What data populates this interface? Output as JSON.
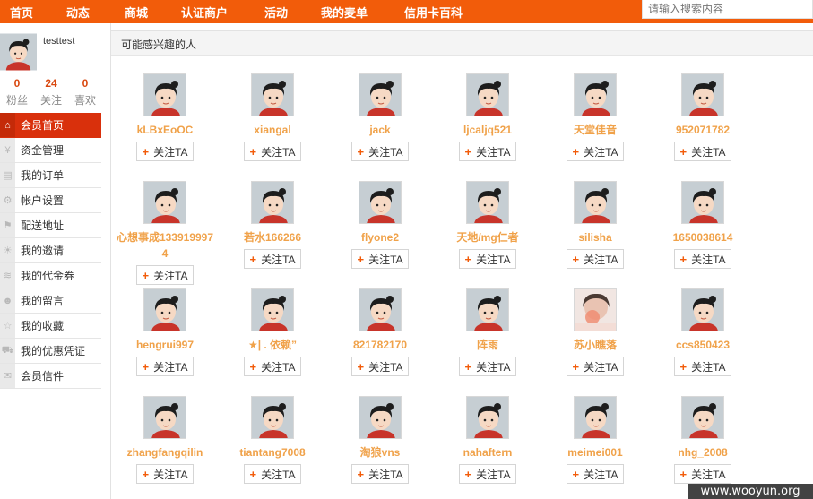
{
  "nav": {
    "links": [
      "首页",
      "动态",
      "商城",
      "认证商户",
      "活动",
      "我的麦单",
      "信用卡百科"
    ],
    "search_placeholder": "请输入搜索内容"
  },
  "profile": {
    "username": "testtest",
    "stats": [
      {
        "num": "0",
        "label": "粉丝"
      },
      {
        "num": "24",
        "label": "关注"
      },
      {
        "num": "0",
        "label": "喜欢"
      }
    ]
  },
  "menu": [
    {
      "label": "会员首页",
      "icon": "home-icon",
      "active": true
    },
    {
      "label": "资金管理",
      "icon": "yen-icon",
      "active": false
    },
    {
      "label": "我的订单",
      "icon": "document-icon",
      "active": false
    },
    {
      "label": "帐户设置",
      "icon": "gear-icon",
      "active": false
    },
    {
      "label": "配送地址",
      "icon": "flag-icon",
      "active": false
    },
    {
      "label": "我的邀请",
      "icon": "sun-icon",
      "active": false
    },
    {
      "label": "我的代金券",
      "icon": "layers-icon",
      "active": false
    },
    {
      "label": "我的留言",
      "icon": "users-icon",
      "active": false
    },
    {
      "label": "我的收藏",
      "icon": "star-icon",
      "active": false
    },
    {
      "label": "我的优惠凭证",
      "icon": "cart-icon",
      "active": false
    },
    {
      "label": "会员信件",
      "icon": "mail-icon",
      "active": false
    }
  ],
  "main": {
    "title": "可能感兴趣的人",
    "follow_label": "关注TA",
    "users": [
      "kLBxEoOC",
      "xiangal",
      "jack",
      "ljcaljq521",
      "天堂佳音",
      "952071782",
      "心想事成1339199974",
      "若水166266",
      "flyone2",
      "天地/mg仁者",
      "silisha",
      "1650038614",
      "hengrui997",
      "★| . 依赖”",
      "821782170",
      "阵雨",
      "苏小瞧落",
      "ccs850423",
      "zhangfangqilin",
      "tiantang7008",
      "淘狼vns",
      "nahaftern",
      "meimei001",
      "nhg_2008"
    ]
  },
  "watermark": "www.wooyun.org"
}
